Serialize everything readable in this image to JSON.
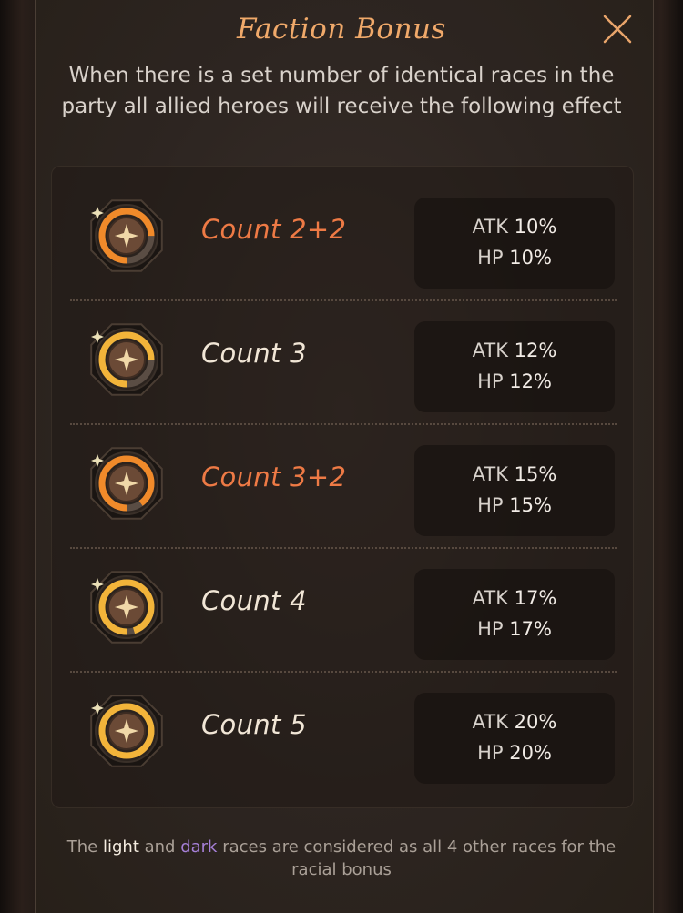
{
  "title": "Faction Bonus",
  "description": "When there is a set number of identical races in the party all allied heroes will receive the following effect",
  "tiers": [
    {
      "label": "Count 2+2",
      "atk_label": "ATK",
      "atk": "10%",
      "hp_label": "HP",
      "hp": "10%",
      "label_color": "#ee7a45",
      "ring_color": "#f08a2a",
      "ring_fill": 0.75
    },
    {
      "label": "Count 3",
      "atk_label": "ATK",
      "atk": "12%",
      "hp_label": "HP",
      "hp": "12%",
      "label_color": "#f1e6d6",
      "ring_color": "#f2b43a",
      "ring_fill": 0.75
    },
    {
      "label": "Count 3+2",
      "atk_label": "ATK",
      "atk": "15%",
      "hp_label": "HP",
      "hp": "15%",
      "label_color": "#ee7a45",
      "ring_color": "#f08a2a",
      "ring_fill": 0.9
    },
    {
      "label": "Count 4",
      "atk_label": "ATK",
      "atk": "17%",
      "hp_label": "HP",
      "hp": "17%",
      "label_color": "#f1e6d6",
      "ring_color": "#f2b43a",
      "ring_fill": 0.95
    },
    {
      "label": "Count 5",
      "atk_label": "ATK",
      "atk": "20%",
      "hp_label": "HP",
      "hp": "20%",
      "label_color": "#f1e6d6",
      "ring_color": "#f2b43a",
      "ring_fill": 1.0
    }
  ],
  "footer": {
    "part1": "The ",
    "light": "light",
    "part2": " and ",
    "dark": "dark",
    "part3": " races are considered as all 4 other races for the racial bonus"
  },
  "icons": {
    "close": "close-icon",
    "tier_badge": "faction-badge-icon"
  },
  "colors": {
    "title": "#f0a96a",
    "light_highlight": "#f4ece0",
    "dark_highlight": "#a57fd6"
  }
}
